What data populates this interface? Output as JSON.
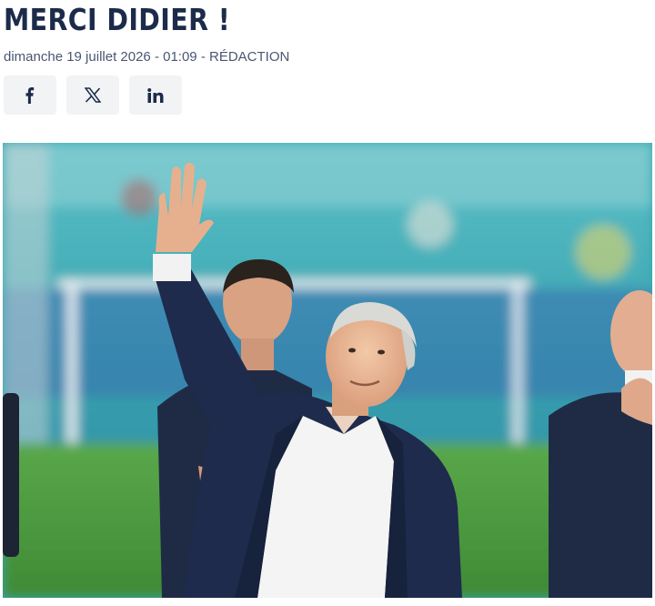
{
  "article": {
    "title": "MERCI DIDIER !",
    "date": "dimanche 19 juillet 2026 - 01:09",
    "separator": " - ",
    "author": "RÉDACTION"
  },
  "share": [
    {
      "network": "facebook",
      "icon": "facebook-icon"
    },
    {
      "network": "x",
      "icon": "x-icon"
    },
    {
      "network": "linkedin",
      "icon": "linkedin-icon"
    }
  ],
  "photo": {
    "subject": "coach-waving-stadium"
  },
  "colors": {
    "title": "#1c2b4a",
    "meta": "#4a5672",
    "share_bg": "#f2f3f5",
    "pitch": "#4e9a3c",
    "stands": "#35a8b3"
  }
}
